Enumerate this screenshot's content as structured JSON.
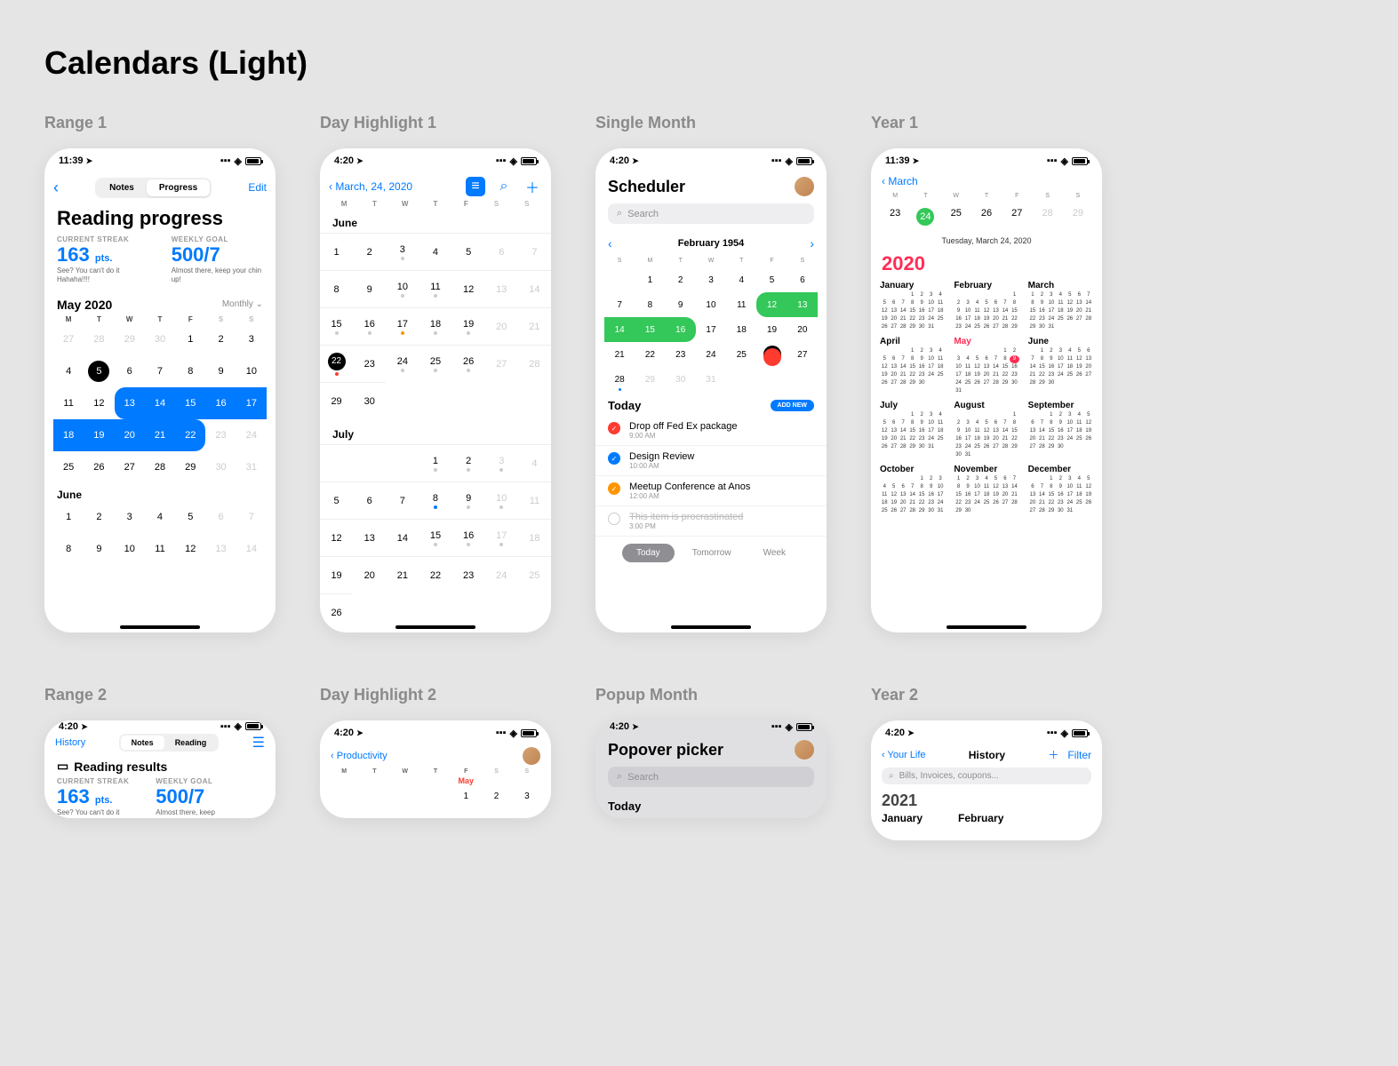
{
  "page_title": "Calendars (Light)",
  "labels": {
    "range1": "Range 1",
    "day_highlight1": "Day Highlight 1",
    "single_month": "Single Month",
    "year1": "Year 1",
    "range2": "Range 2",
    "day_highlight2": "Day Highlight 2",
    "popup_month": "Popup Month",
    "year2": "Year 2"
  },
  "status": {
    "t1": "11:39",
    "t2": "4:20"
  },
  "dow": {
    "mon": [
      "M",
      "T",
      "W",
      "T",
      "F",
      "S",
      "S"
    ],
    "sun": [
      "S",
      "M",
      "T",
      "W",
      "T",
      "F",
      "S"
    ]
  },
  "range1": {
    "seg": [
      "Notes",
      "Progress"
    ],
    "seg_active": 1,
    "edit": "Edit",
    "title": "Reading progress",
    "streak_lbl": "CURRENT STREAK",
    "streak_val": "163",
    "streak_unit": "pts.",
    "streak_sub": "See? You can't do it Hahaha!!!!",
    "goal_lbl": "WEEKLY GOAL",
    "goal_val": "500/7",
    "goal_sub": "Almost there, keep your chin up!",
    "month": "May 2020",
    "monthly": "Monthly",
    "selected": 5,
    "range_start": 13,
    "range_end": 22,
    "next_month": "June"
  },
  "dh1": {
    "date": "March, 24, 2020",
    "months": [
      "June",
      "July"
    ]
  },
  "single_month": {
    "title": "Scheduler",
    "search": "Search",
    "month": "February 1954",
    "range": [
      12,
      16
    ],
    "today": 26,
    "today_lbl": "Today",
    "add": "ADD NEW",
    "items": [
      {
        "kind": "red",
        "title": "Drop off Fed Ex package",
        "time": "9:00 AM"
      },
      {
        "kind": "blue",
        "title": "Design Review",
        "time": "10:00 AM"
      },
      {
        "kind": "orange",
        "title": "Meetup Conference at Anos",
        "time": "12:00 AM"
      },
      {
        "kind": "empty",
        "title": "This item is procrastinated",
        "time": "3:00 PM",
        "strike": true
      }
    ],
    "tabs": [
      "Today",
      "Tomorrow",
      "Week"
    ],
    "tab_active": 0
  },
  "year1": {
    "back": "March",
    "week_days": [
      23,
      24,
      25,
      26,
      27,
      28,
      29
    ],
    "week_today": 24,
    "full_date": "Tuesday, March 24, 2020",
    "year": "2020",
    "months": [
      "January",
      "February",
      "March",
      "April",
      "May",
      "June",
      "July",
      "August",
      "September",
      "October",
      "November",
      "December"
    ],
    "current_month_index": 4,
    "highlighted_day": 9,
    "month_starts": [
      3,
      6,
      0,
      3,
      5,
      1,
      3,
      6,
      2,
      4,
      0,
      2
    ],
    "month_days": [
      31,
      29,
      31,
      30,
      31,
      30,
      31,
      31,
      30,
      31,
      30,
      31
    ]
  },
  "range2": {
    "history": "History",
    "seg": [
      "Notes",
      "Reading"
    ],
    "seg_active": 0,
    "title": "Reading results",
    "streak_lbl": "CURRENT STREAK",
    "streak_val": "163",
    "streak_unit": "pts.",
    "streak_sub": "See? You can't do it",
    "goal_lbl": "WEEKLY GOAL",
    "goal_val": "500/7",
    "goal_sub": "Almost there, keep"
  },
  "dh2": {
    "back": "Productivity",
    "may": "May"
  },
  "popup": {
    "title": "Popover picker",
    "search": "Search",
    "today": "Today"
  },
  "year2": {
    "back": "Your Life",
    "title": "History",
    "filter": "Filter",
    "search": "Bills, Invoices, coupons...",
    "year": "2021",
    "months": [
      "January",
      "February"
    ]
  }
}
